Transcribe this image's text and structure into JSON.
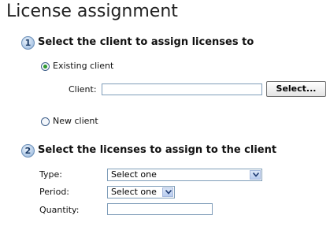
{
  "title": "License assignment",
  "steps": [
    {
      "number": "1",
      "heading": "Select the client to assign licenses to"
    },
    {
      "number": "2",
      "heading": "Select the licenses to assign to the client"
    }
  ],
  "client_section": {
    "existing_client_label": "Existing client",
    "existing_client_selected": true,
    "client_label": "Client:",
    "client_value": "",
    "select_button_label": "Select...",
    "new_client_label": "New client",
    "new_client_selected": false
  },
  "license_section": {
    "type_label": "Type:",
    "type_selected": "Select one",
    "period_label": "Period:",
    "period_selected": "Select one",
    "quantity_label": "Quantity:",
    "quantity_value": ""
  },
  "colors": {
    "accent_radio": "#2e9a2e",
    "input_border": "#7f9db9",
    "step_badge": "#8fb0d6"
  },
  "icons": {
    "dropdown": "chevron-down-icon"
  }
}
